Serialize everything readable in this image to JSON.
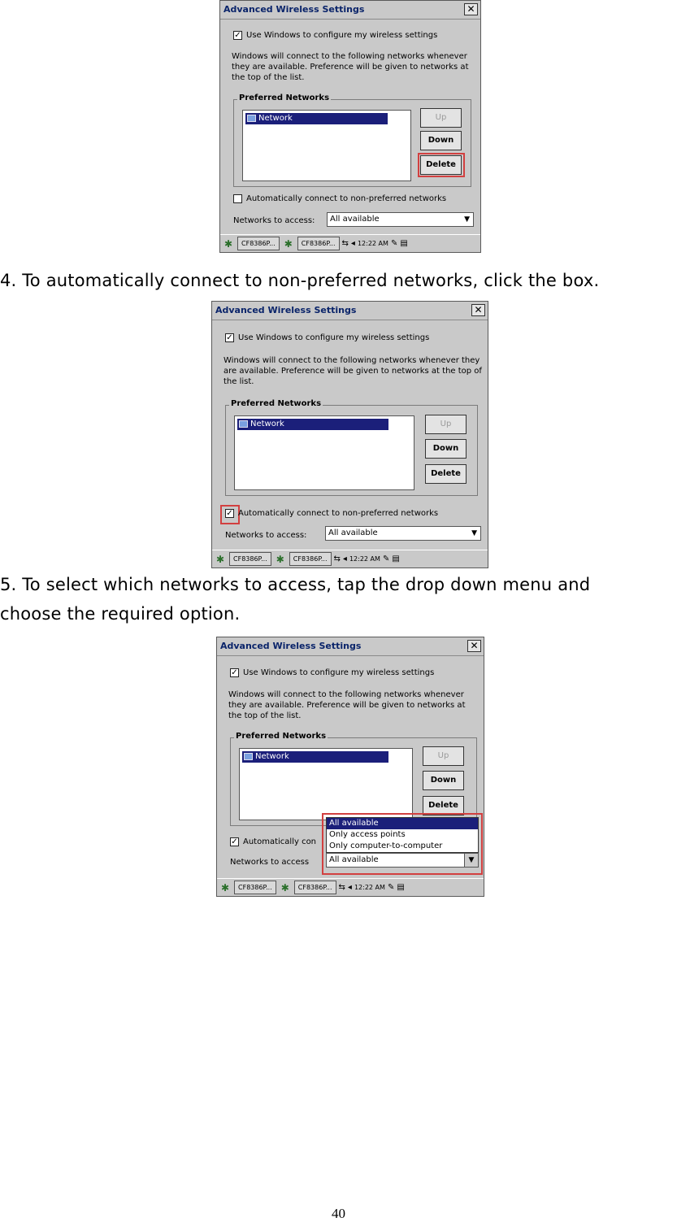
{
  "dialog": {
    "title": "Advanced Wireless Settings",
    "close_symbol": "✕",
    "use_windows_label": "Use Windows to configure my wireless settings",
    "description": "Windows will connect to the following networks whenever they are available. Preference will be given to networks at the top of the list.",
    "preferred_group_label": "Preferred Networks",
    "network_item": "Network",
    "up_label": "Up",
    "down_label": "Down",
    "delete_label": "Delete",
    "auto_connect_label": "Automatically connect to non-preferred networks",
    "auto_connect_label_truncated": "Automatically con",
    "networks_to_access_label": "Networks to access:",
    "networks_to_access_label_truncated": "Networks to access",
    "networks_to_access_value": "All available",
    "dropdown_options": [
      "All available",
      "Only access points",
      "Only computer-to-computer"
    ],
    "check_mark": "✓",
    "arrow_symbol": "▼"
  },
  "taskbar": {
    "task1": "CF8386P...",
    "task2": "CF8386P...",
    "time": "12:22 AM"
  },
  "steps": {
    "step4": "4. To automatically connect to non-preferred networks, click the box.",
    "step5_line1": "5. To select which networks to access, tap the drop down menu and",
    "step5_line2": "choose the required option."
  },
  "page_number": "40",
  "colors": {
    "highlight": "#d24040",
    "selection": "#1b1f7a",
    "dialog_bg": "#c9c9c9"
  }
}
